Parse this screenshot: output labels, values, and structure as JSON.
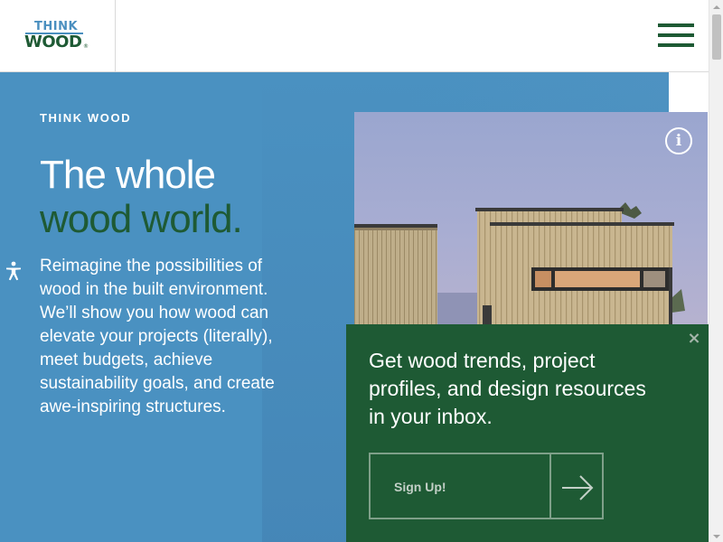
{
  "header": {
    "logo": {
      "line1": "THINK",
      "line2": "WOOD",
      "mark": "®"
    },
    "menu_icon": "hamburger-menu-icon"
  },
  "hero": {
    "eyebrow": "THINK WOOD",
    "headline_line1": "The whole",
    "headline_line2": "wood world.",
    "body_lines": [
      "Reimagine the possibilities of",
      "wood in the built environment.",
      "We’ll show you how wood can",
      "elevate your projects (literally),",
      "meet budgets, achieve",
      "sustainability goals, and create",
      "awe-inspiring structures."
    ],
    "info_glyph": "i"
  },
  "signup": {
    "text_lines": [
      "Get wood trends, project",
      "profiles, and design resources",
      "in your inbox."
    ],
    "button_label": "Sign Up!",
    "close_glyph": "×"
  },
  "colors": {
    "brand_green": "#1e5a34",
    "brand_blue": "#4a91c1",
    "white": "#ffffff"
  }
}
